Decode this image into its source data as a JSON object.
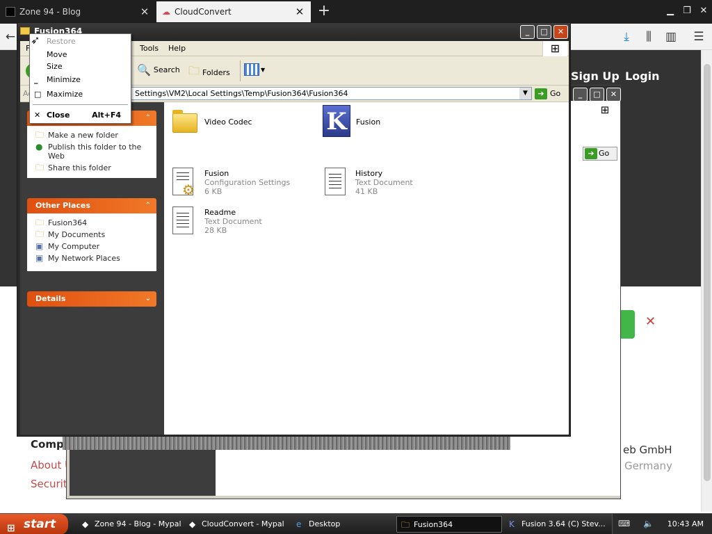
{
  "browser": {
    "tabs": [
      {
        "title": "Zone 94 - Blog",
        "active": false
      },
      {
        "title": "CloudConvert",
        "active": true
      }
    ],
    "new_tab_label": "+"
  },
  "webpage": {
    "nav": {
      "signup": "Sign Up",
      "login": "Login"
    },
    "footer": {
      "heading_partial": "Comp",
      "about_partial": "About U",
      "security_partial": "Security",
      "company_partial": "eb GmbH",
      "country_partial": "Germany"
    }
  },
  "explorer": {
    "title": "Fusion364",
    "menu": {
      "file_partial": "F",
      "tools": "Tools",
      "help": "Help"
    },
    "toolbar": {
      "search": "Search",
      "folders": "Folders"
    },
    "address": {
      "label_partial": "Ad",
      "path": "Settings\\VM2\\Local Settings\\Temp\\Fusion364\\Fusion364",
      "go": "Go"
    },
    "tasks_panel": {
      "links": [
        "Make a new folder",
        "Publish this folder to the Web",
        "Share this folder"
      ]
    },
    "other_places": {
      "title": "Other Places",
      "links": [
        "Fusion364",
        "My Documents",
        "My Computer",
        "My Network Places"
      ]
    },
    "details": {
      "title": "Details"
    },
    "files": [
      {
        "name": "Video Codec",
        "type": "",
        "size": ""
      },
      {
        "name": "Fusion",
        "type": "",
        "size": ""
      },
      {
        "name": "Fusion",
        "type": "Configuration Settings",
        "size": "6 KB"
      },
      {
        "name": "History",
        "type": "Text Document",
        "size": "41 KB"
      },
      {
        "name": "Readme",
        "type": "Text Document",
        "size": "28 KB"
      }
    ]
  },
  "back_window": {
    "go": "Go"
  },
  "system_menu": {
    "restore": "Restore",
    "move": "Move",
    "size": "Size",
    "minimize": "Minimize",
    "maximize": "Maximize",
    "close": "Close",
    "close_accel": "Alt+F4"
  },
  "taskbar": {
    "start": "start",
    "tasks": [
      {
        "label": "Zone 94 - Blog - Mypal"
      },
      {
        "label": "CloudConvert - Mypal"
      },
      {
        "label": "Desktop"
      },
      {
        "label": "Fusion364"
      },
      {
        "label": "Fusion 3.64 (C) Stev..."
      }
    ],
    "clock": "10:43 AM"
  },
  "colors": {
    "xp_orange": "#e05010",
    "go_green": "#3a9d23",
    "start_orange": "#e85a2a"
  }
}
